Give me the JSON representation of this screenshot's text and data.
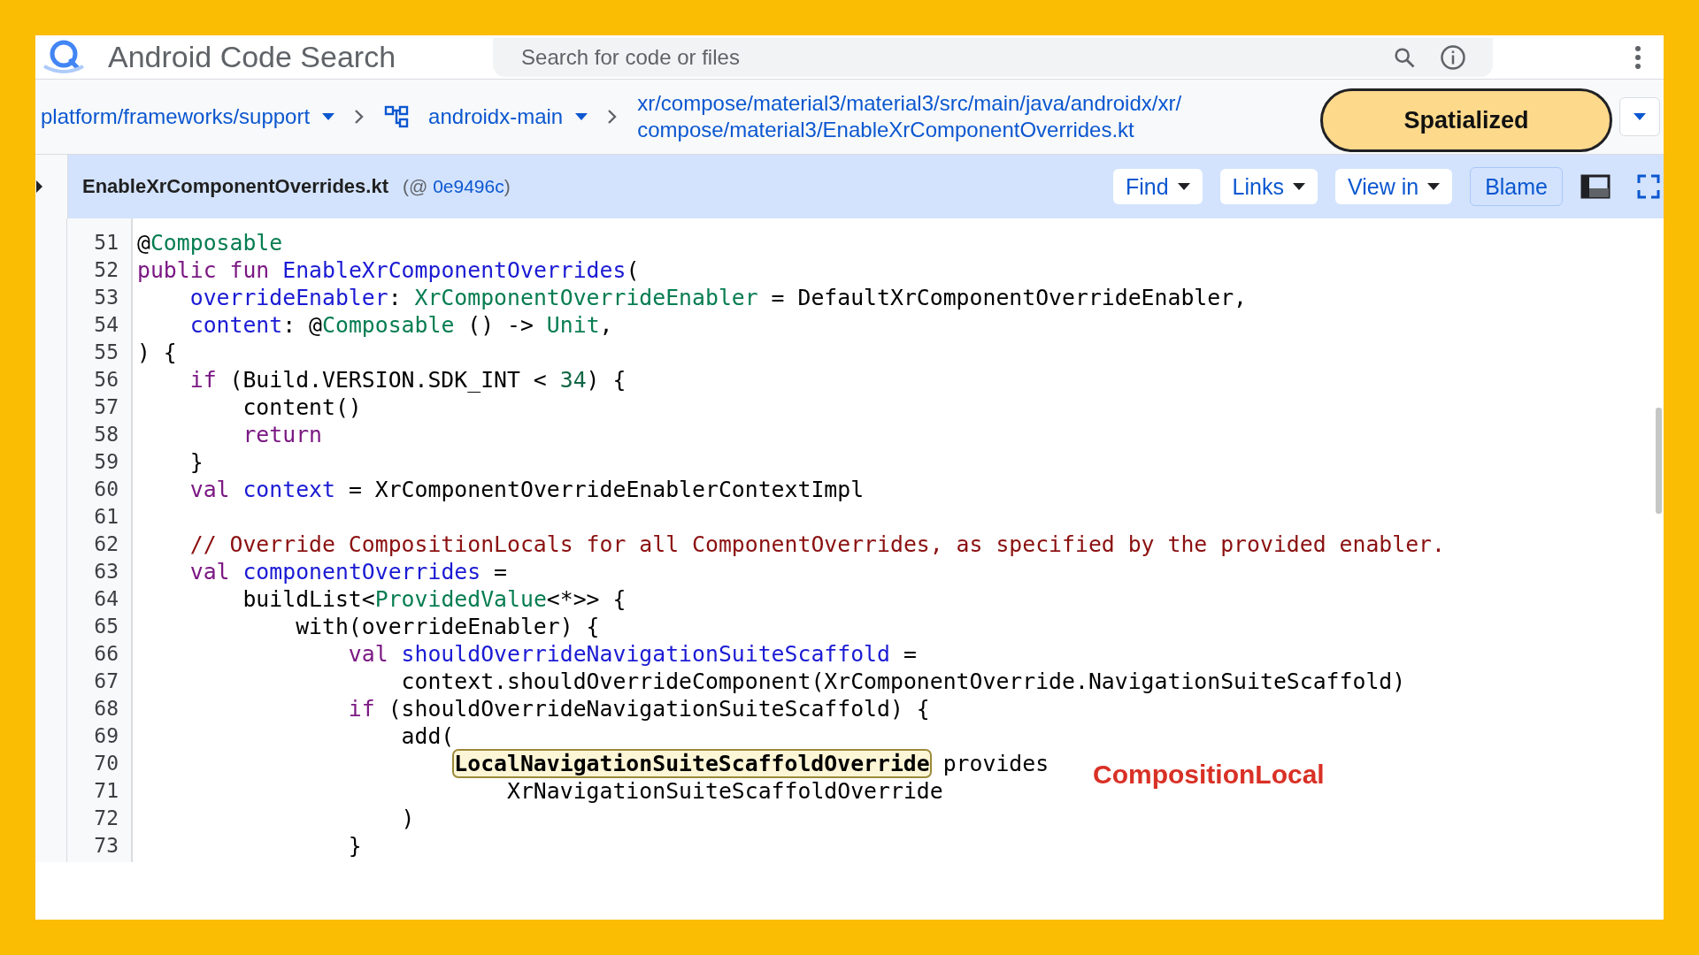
{
  "header": {
    "title": "Android Code Search",
    "search": {
      "placeholder": "Search for code or files"
    }
  },
  "breadcrumb": {
    "repository": "platform/frameworks/support",
    "branch": "androidx-main",
    "path": [
      "xr/compose/material3/material3/src/main/java/androidx/xr/",
      "compose/material3/EnableXrComponentOverrides.kt"
    ]
  },
  "badge": "Spatialized",
  "file": {
    "name": "EnableXrComponentOverrides.kt",
    "revision_prefix": "(@ ",
    "revision": "0e9496c",
    "revision_suffix": ")"
  },
  "toolbar": [
    {
      "label": "Find",
      "kind": "dropdown"
    },
    {
      "label": "Links",
      "kind": "dropdown"
    },
    {
      "label": "View in",
      "kind": "dropdown"
    },
    {
      "label": "Blame",
      "kind": "toggle"
    }
  ],
  "code": {
    "lines": [
      {
        "number": "51",
        "tokens": [
          {
            "text": "@",
            "kind": "plain"
          },
          {
            "text": "Composable",
            "kind": "type"
          }
        ]
      },
      {
        "number": "52",
        "tokens": [
          {
            "text": "public fun ",
            "kind": "keyword"
          },
          {
            "text": "EnableXrComponentOverrides",
            "kind": "identifier"
          },
          {
            "text": "(",
            "kind": "plain"
          }
        ]
      },
      {
        "number": "53",
        "tokens": [
          {
            "text": "    overrideEnabler",
            "kind": "identifier"
          },
          {
            "text": ": ",
            "kind": "plain"
          },
          {
            "text": "XrComponentOverrideEnabler",
            "kind": "type"
          },
          {
            "text": " = DefaultXrComponentOverrideEnabler,",
            "kind": "plain"
          }
        ]
      },
      {
        "number": "54",
        "tokens": [
          {
            "text": "    content",
            "kind": "identifier"
          },
          {
            "text": ": @",
            "kind": "plain"
          },
          {
            "text": "Composable",
            "kind": "type"
          },
          {
            "text": " () -> ",
            "kind": "plain"
          },
          {
            "text": "Unit",
            "kind": "type"
          },
          {
            "text": ",",
            "kind": "plain"
          }
        ]
      },
      {
        "number": "55",
        "tokens": [
          {
            "text": ") {",
            "kind": "plain"
          }
        ]
      },
      {
        "number": "56",
        "tokens": [
          {
            "text": "    if",
            "kind": "keyword"
          },
          {
            "text": " (Build.VERSION.SDK_INT < ",
            "kind": "plain"
          },
          {
            "text": "34",
            "kind": "number"
          },
          {
            "text": ") {",
            "kind": "plain"
          }
        ]
      },
      {
        "number": "57",
        "tokens": [
          {
            "text": "        content()",
            "kind": "plain"
          }
        ]
      },
      {
        "number": "58",
        "tokens": [
          {
            "text": "        return",
            "kind": "keyword"
          }
        ]
      },
      {
        "number": "59",
        "tokens": [
          {
            "text": "    }",
            "kind": "plain"
          }
        ]
      },
      {
        "number": "60",
        "tokens": [
          {
            "text": "    val",
            "kind": "keyword"
          },
          {
            "text": " context",
            "kind": "identifier"
          },
          {
            "text": " = XrComponentOverrideEnablerContextImpl",
            "kind": "plain"
          }
        ]
      },
      {
        "number": "61"
      },
      {
        "number": "62",
        "tokens": [
          {
            "text": "    // Override CompositionLocals for all ComponentOverrides, as specified by the provided enabler.",
            "kind": "comment"
          }
        ]
      },
      {
        "number": "63",
        "tokens": [
          {
            "text": "    val",
            "kind": "keyword"
          },
          {
            "text": " componentOverrides",
            "kind": "identifier"
          },
          {
            "text": " =",
            "kind": "plain"
          }
        ]
      },
      {
        "number": "64",
        "tokens": [
          {
            "text": "        buildList<",
            "kind": "plain"
          },
          {
            "text": "ProvidedValue",
            "kind": "type"
          },
          {
            "text": "<*>> {",
            "kind": "plain"
          }
        ]
      },
      {
        "number": "65",
        "tokens": [
          {
            "text": "            with(overrideEnabler) {",
            "kind": "plain"
          }
        ]
      },
      {
        "number": "66",
        "tokens": [
          {
            "text": "                val",
            "kind": "keyword"
          },
          {
            "text": " shouldOverrideNavigationSuiteScaffold",
            "kind": "identifier"
          },
          {
            "text": " =",
            "kind": "plain"
          }
        ]
      },
      {
        "number": "67",
        "tokens": [
          {
            "text": "                    context.shouldOverrideComponent(XrComponentOverride.NavigationSuiteScaffold)",
            "kind": "plain"
          }
        ]
      },
      {
        "number": "68",
        "tokens": [
          {
            "text": "                if",
            "kind": "keyword"
          },
          {
            "text": " (shouldOverrideNavigationSuiteScaffold) {",
            "kind": "plain"
          }
        ]
      },
      {
        "number": "69",
        "tokens": [
          {
            "text": "                    add(",
            "kind": "plain"
          }
        ]
      },
      {
        "number": "70",
        "tokens": [
          {
            "text": "LocalNavigationSuiteScaffoldOverride",
            "kind": "highlight"
          },
          {
            "text": " provides",
            "kind": "plain"
          }
        ]
      },
      {
        "number": "71",
        "tokens": [
          {
            "text": "                            XrNavigationSuiteScaffoldOverride",
            "kind": "plain"
          }
        ]
      },
      {
        "number": "72",
        "tokens": [
          {
            "text": "                    )",
            "kind": "plain"
          }
        ]
      },
      {
        "number": "73",
        "tokens": [
          {
            "text": "                }",
            "kind": "plain"
          }
        ]
      }
    ]
  },
  "annotation": "CompositionLocal"
}
